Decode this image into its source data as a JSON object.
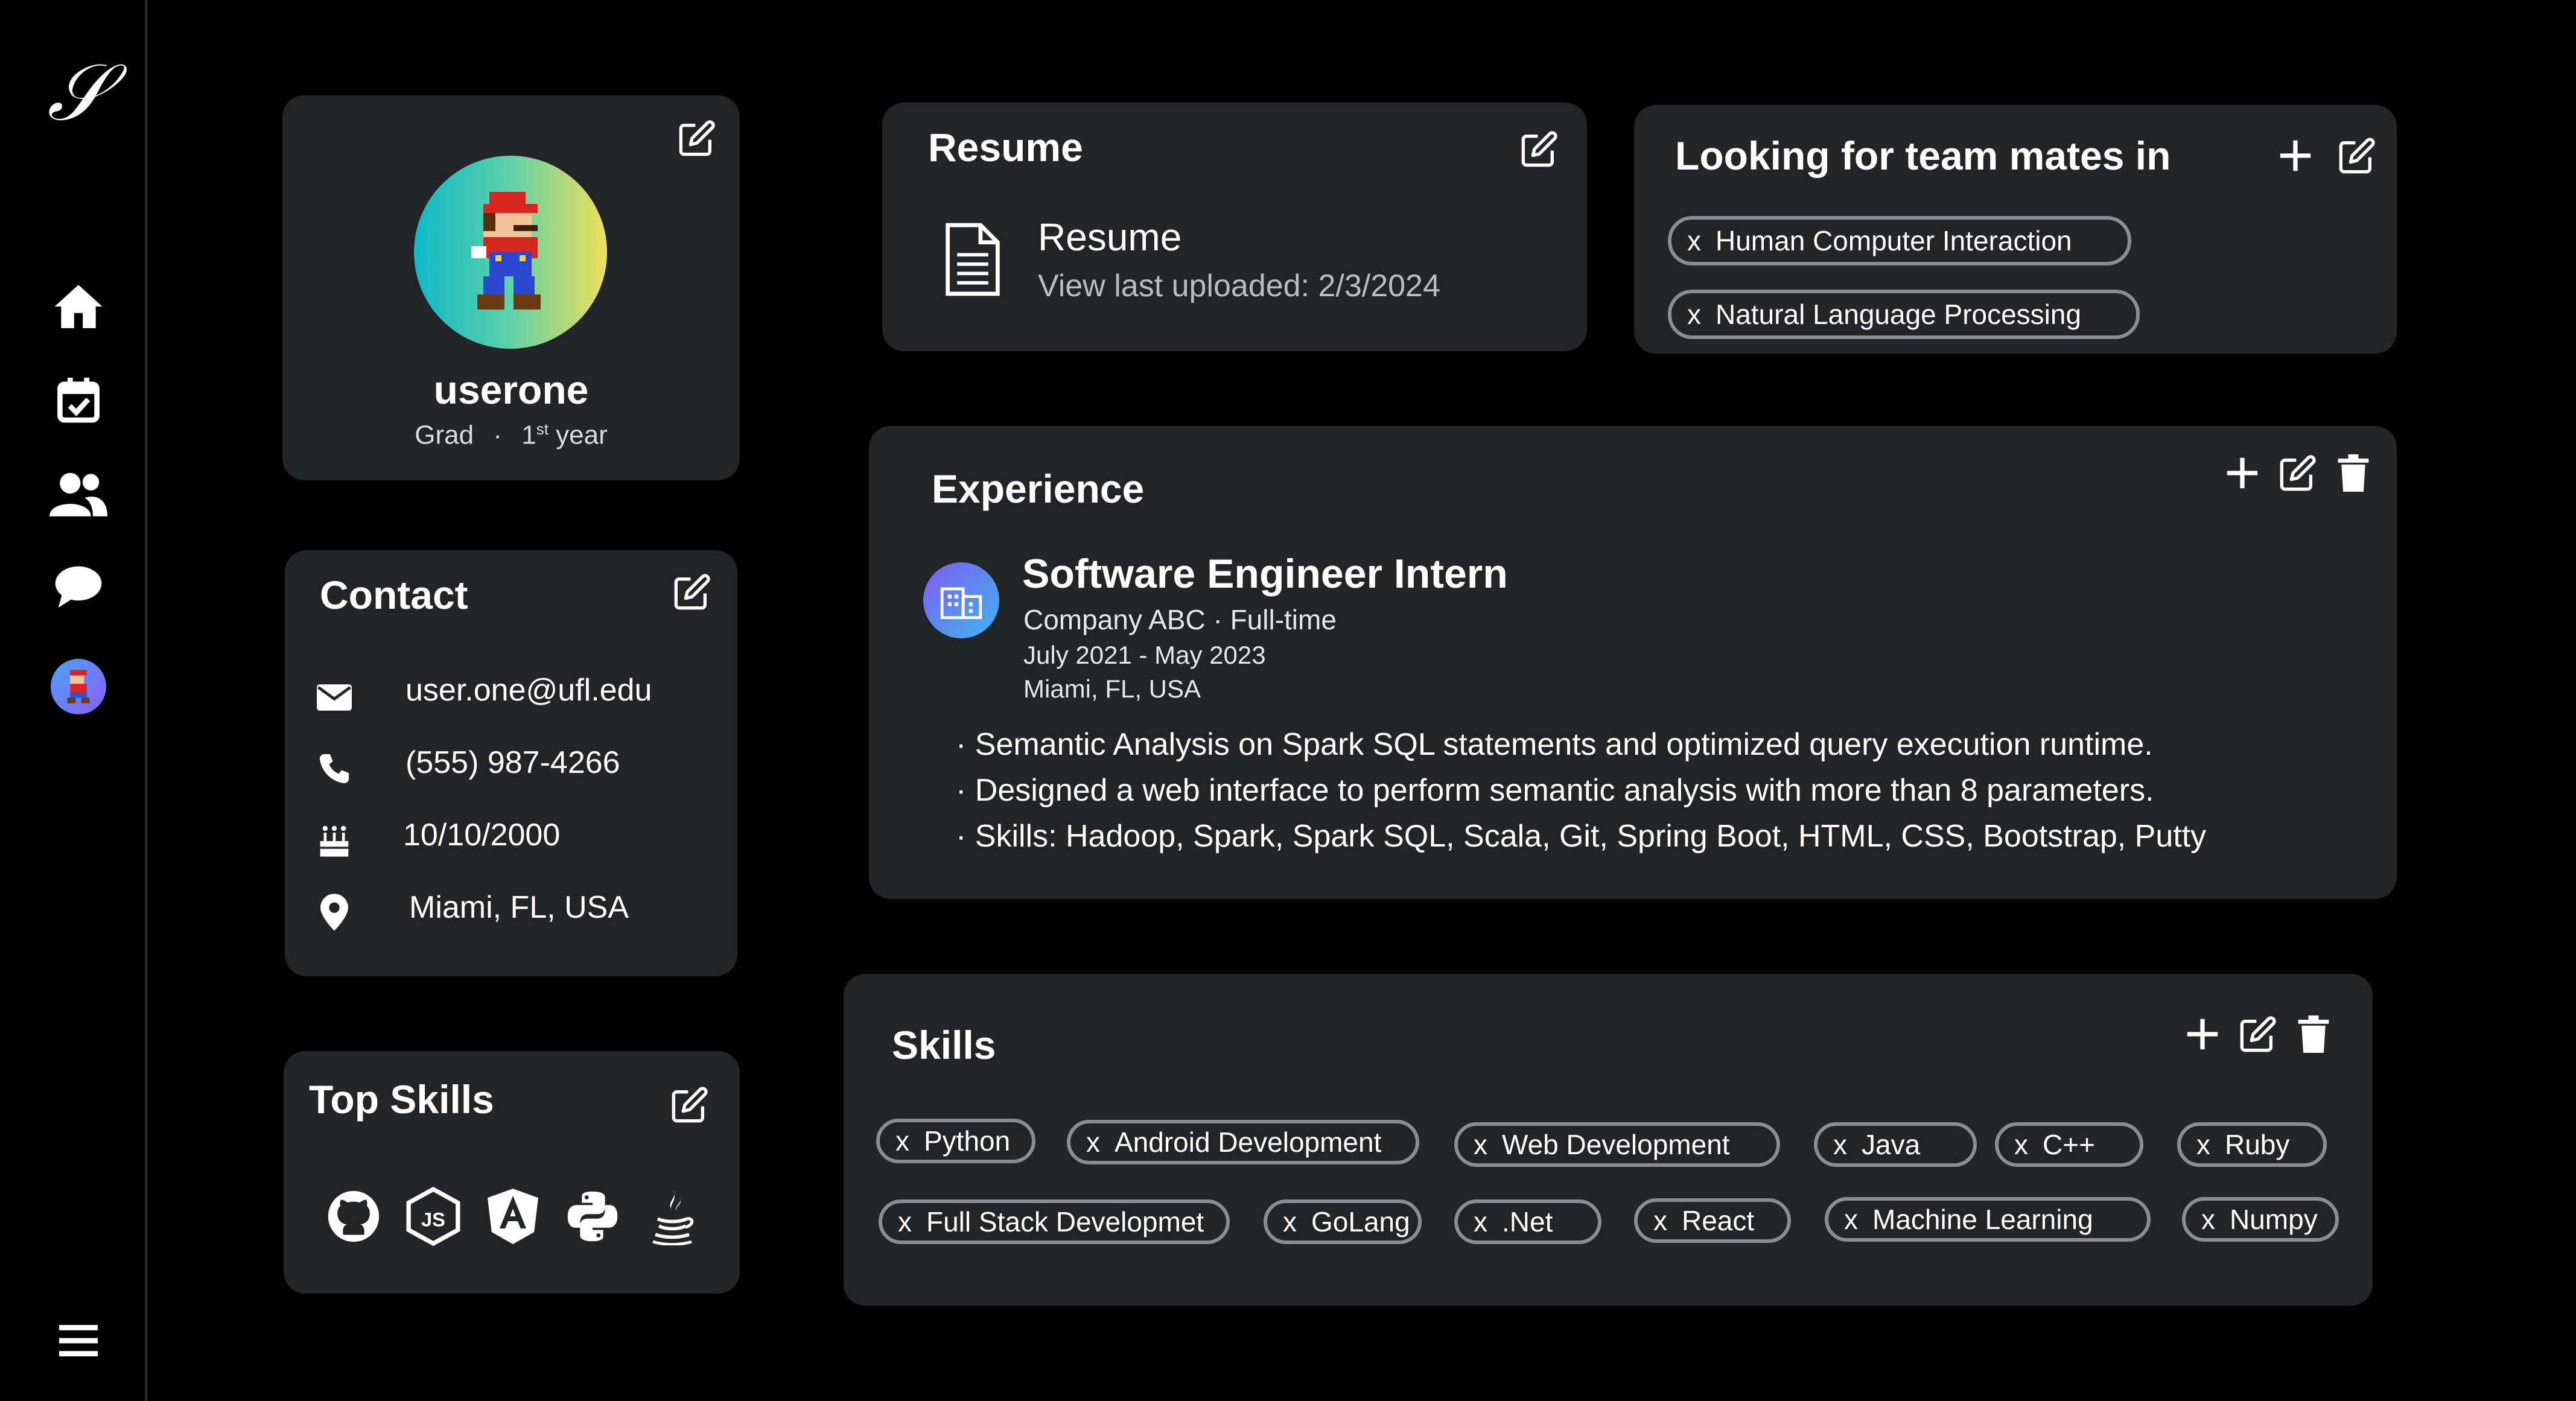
{
  "app": {
    "logo_glyph": "𝒮"
  },
  "sidebar": {
    "items": [
      {
        "name": "home-icon"
      },
      {
        "name": "calendar-check-icon"
      },
      {
        "name": "users-icon"
      },
      {
        "name": "chat-icon"
      },
      {
        "name": "avatar"
      }
    ],
    "menu_icon": "menu-icon"
  },
  "profile": {
    "username": "userone",
    "level": "Grad",
    "separator": "·",
    "year_num": "1",
    "year_sup": "st",
    "year_word": "year"
  },
  "contact": {
    "title": "Contact",
    "email": "user.one@ufl.edu",
    "phone": "(555) 987-4266",
    "birthday": "10/10/2000",
    "location": "Miami, FL, USA"
  },
  "top_skills": {
    "title": "Top Skills",
    "icons": [
      "github-icon",
      "nodejs-icon",
      "angular-icon",
      "python-icon",
      "java-icon"
    ]
  },
  "resume": {
    "title": "Resume",
    "file_label": "Resume",
    "subtitle": "View last uploaded: 2/3/2024"
  },
  "team": {
    "title": "Looking for team mates in",
    "chips": [
      "Human Computer Interaction",
      "Natural Language Processing"
    ]
  },
  "experience": {
    "title": "Experience",
    "role": "Software Engineer Intern",
    "company": "Company ABC · Full-time",
    "dates": "July 2021 - May 2023",
    "location": "Miami, FL, USA",
    "bullets": [
      "· Semantic Analysis on Spark SQL statements and optimized query execution runtime.",
      "· Designed a web interface to perform semantic analysis with more than 8 parameters.",
      "· Skills: Hadoop, Spark, Spark SQL, Scala, Git, Spring Boot, HTML, CSS, Bootstrap, Putty"
    ]
  },
  "skills": {
    "title": "Skills",
    "chips": [
      "Python",
      "Android Development",
      "Web Development",
      "Java",
      "C++",
      "Ruby",
      "Full Stack Developmet",
      "GoLang",
      ".Net",
      "React",
      "Machine Learning",
      "Numpy"
    ]
  },
  "chip_remove_glyph": "x",
  "colors": {
    "background": "#000000",
    "card": "#222426",
    "chip_border": "#8a8d91",
    "muted_text": "#b9bcc0"
  }
}
